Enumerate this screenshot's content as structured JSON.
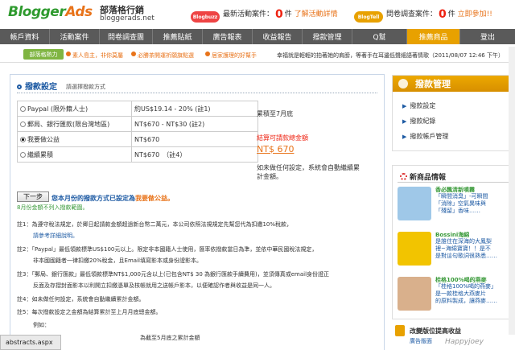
{
  "header": {
    "logo_a": "Blogger",
    "logo_b": "Ads",
    "logo_zh": "部落格行銷",
    "logo_url": "bloggerads.net",
    "buzz_badge": "Blogbuzz",
    "buzz_label": "最新活動案件：",
    "buzz_count": "0",
    "buzz_unit": "件",
    "buzz_link": "了解活動詳情",
    "tell_badge": "BlogTell",
    "tell_label": "問卷調查案件：",
    "tell_count": "0",
    "tell_unit": "件",
    "tell_link": "立即參加!!"
  },
  "nav": [
    {
      "label": "帳戶資料",
      "w": 62
    },
    {
      "label": "活動案件",
      "w": 62
    },
    {
      "label": "問卷調查團",
      "w": 66
    },
    {
      "label": "推薦貼紙",
      "w": 62
    },
    {
      "label": "廣告報表",
      "w": 62
    },
    {
      "label": "收益報告",
      "w": 62
    },
    {
      "label": "撥款管理",
      "w": 62
    },
    {
      "label": "Q幫",
      "w": 68
    },
    {
      "label": "推薦商品",
      "w": 66
    },
    {
      "label": "登出",
      "w": 68
    }
  ],
  "ticker": {
    "tag": "部落格熱力",
    "items": [
      "素人島主，非你莫屬",
      "必勝茶開運祈願旗點選",
      "居家護理的好幫手"
    ],
    "quote": "幸福就是輕輕的拍著她的肩膀，等著手在耳邊低聲細語著情歌（2011/08/07 12:46 下午）"
  },
  "main": {
    "title": "撥款設定",
    "subtitle": "請選擇撥款方式",
    "options": [
      {
        "label": "Paypal (限外籍人士)",
        "fee": "約US$19.14 - 20% (註1)",
        "checked": false
      },
      {
        "label": "郵局、銀行匯款(限台灣地區)",
        "fee": "NT$670 - NT$30 (註2)",
        "checked": false
      },
      {
        "label": "我要做公益",
        "fee": "NT$670",
        "checked": true
      },
      {
        "label": "繼續累積",
        "fee": "NT$670　（註4）",
        "checked": false
      }
    ],
    "accum": "累積至7月底",
    "balance_label": "結算可請款總金額",
    "balance_value": "NT$ 670",
    "auto_note_1": "如未做任何設定，系統會自動繼續累",
    "auto_note_2": "計金額。",
    "next_button": "下一步",
    "next_msg_pre": "您本月份的撥款方式已設定為",
    "next_msg_hl": "我要做公益。",
    "next_warn": "8月份金額不列入撥款範圍。",
    "notes": [
      "註1：為遵守稅法規定，於卿日起請款金額超過新台幣二萬元，本公司依照法規規定先幫您代為扣繳10%稅款，",
      "請參考詳細說明。",
      "註2：「Paypal」最低領款標準US$100元以上。限定非本國籍人士使用，匯率依撥款當日為準，並依中華民國稅法規定，",
      "非本國國籍者一律扣繳20%稅金，且Email填寫影本或身份證影本。",
      "註3：「郵局、銀行匯款」最低領款標準NT$1,000元含以上(已包含NT$ 30 為銀行匯款手續費用)，並須傳真或email身份證正",
      "反面及存摺封面影本以利開立扣繳憑單及核帳就用之送帳戶影本，以便確認作者與收益是同一人。",
      "註4：如未做任何設定，系統會自動繼續累計金額。",
      "註5：每次撥款設定之金額為結算累計至上月月底總金額。",
      "例如：",
      "　　　　　　　　　　　　　　　　　　　為截至5月底之累計金額"
    ]
  },
  "status_bar": "abstracts.aspx",
  "right": {
    "title": "撥款管理",
    "links": [
      "撥款設定",
      "撥款紀錄",
      "撥款帳戶管理"
    ],
    "products_title": "新商品情報",
    "products": [
      {
        "name": "香必飄清新噴霧",
        "desc": [
          "「瞬間消臭」-可瞬間",
          "「消除」空氣異味與",
          "「殘留」香味……"
        ],
        "color": "#9fc8e8"
      },
      {
        "name": "Bossini海綿",
        "desc": [
          "是誰住在深海的大鳳梨",
          "裡~海綿寶寶！！是不",
          "是對這句歌詞很熟悉……"
        ],
        "color": "#f2c400"
      },
      {
        "name": "桂格100%喝的燕麥",
        "desc": [
          "「桂格100%喝的燕麥」",
          "是一款桂格大燕麥片",
          "的原料製成，讓燕麥……"
        ],
        "color": "#d9b08c"
      }
    ],
    "tips_title": "改變版位提高收益",
    "tips_sub": "廣告版面",
    "watermark": "Happyjoey"
  }
}
